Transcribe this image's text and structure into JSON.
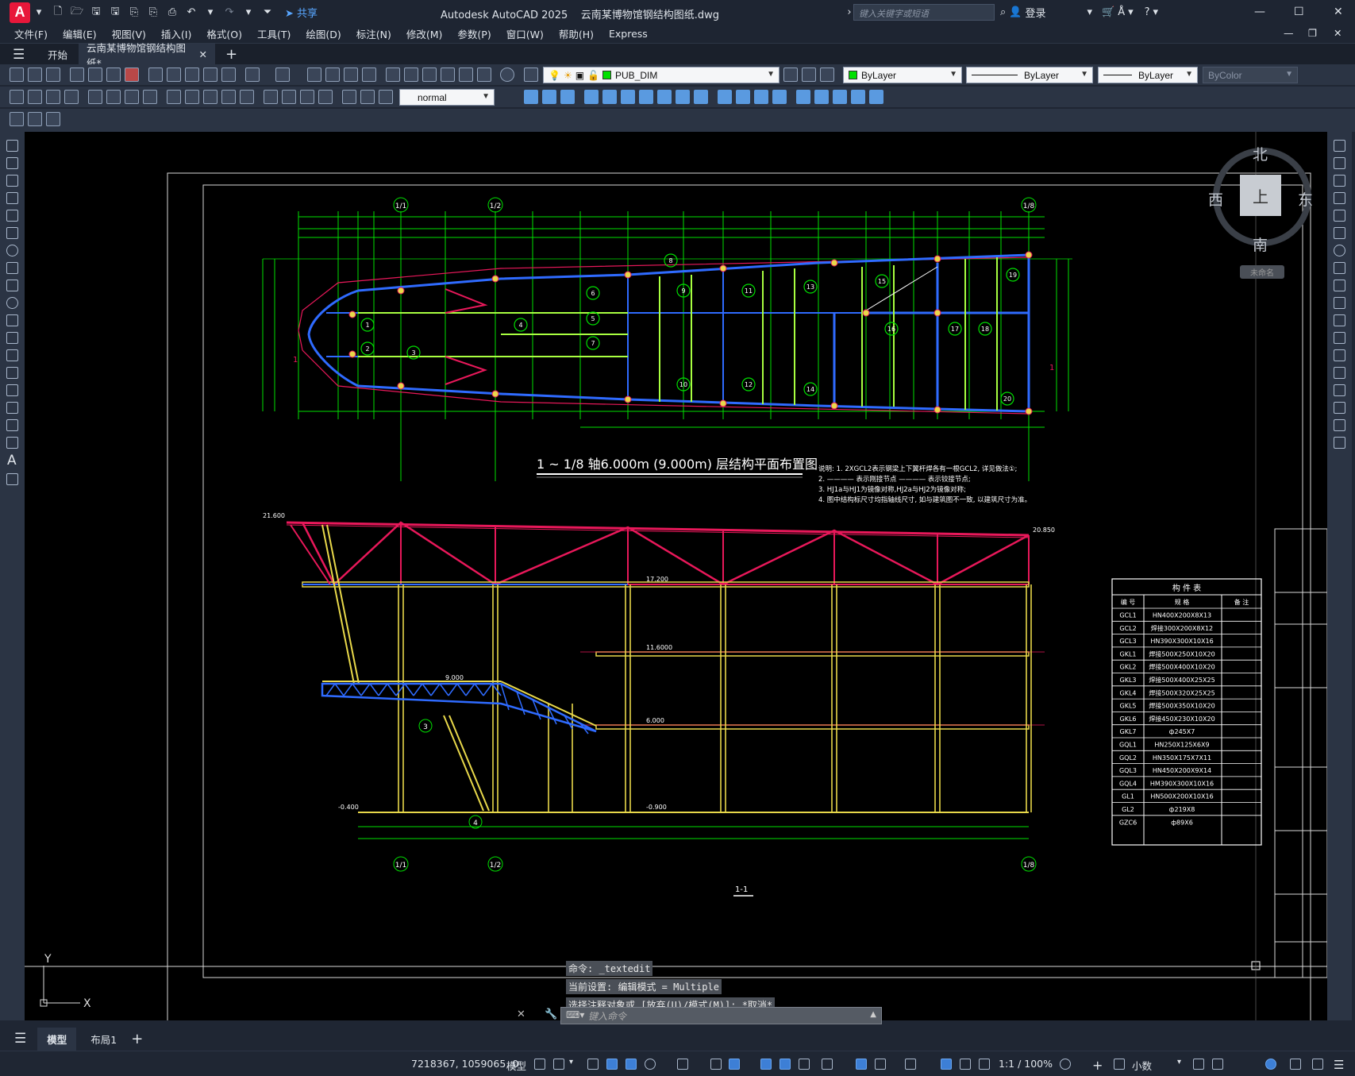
{
  "app": {
    "title": "Autodesk AutoCAD 2025",
    "file": "云南某博物馆钢结构图纸.dwg",
    "share_label": "共享",
    "search_placeholder": "键入关键字或短语",
    "login_label": "登录"
  },
  "menu": [
    "文件(F)",
    "编辑(E)",
    "视图(V)",
    "插入(I)",
    "格式(O)",
    "工具(T)",
    "绘图(D)",
    "标注(N)",
    "修改(M)",
    "参数(P)",
    "窗口(W)",
    "帮助(H)",
    "Express"
  ],
  "tabs": {
    "start": "开始",
    "drawing": "云南某博物馆钢结构图纸*"
  },
  "layer_combo": "PUB_DIM",
  "color_combo": "ByLayer",
  "linetype_combo": "ByLayer",
  "lineweight_combo": "ByLayer",
  "plotstyle_combo": "ByColor",
  "textstyle_combo": "normal",
  "viewcube": {
    "north": "北",
    "south": "南",
    "east": "东",
    "west": "西",
    "face": "上",
    "name": "未命名"
  },
  "drawing": {
    "plan_title": "1 ~ 1/8 轴6.000m (9.000m) 层结构平面布置图",
    "notes": [
      "说明: 1. 2XGCL2表示钢梁上下翼杆焊各有一根GCL2, 详见做法①;",
      "2. ———— 表示刚接节点        ———— 表示铰接节点;",
      "3. HJ1a与HJ1为镜像对称,HJ2a与HJ2为镜像对称;",
      "4. 图中结构标尺寸均指轴线尺寸, 如与建筑图不一致, 以建筑尺寸为准。"
    ],
    "axis_labels": [
      "1/1",
      "1/2",
      "1/8"
    ],
    "elevations": [
      "21.600",
      "17.200",
      "11.6000",
      "6.000",
      "9.000",
      "-0.400",
      "-0.900",
      "20.850"
    ],
    "section_label": "1-1",
    "callouts": [
      "1",
      "2",
      "3",
      "4",
      "5",
      "6",
      "7",
      "8",
      "9",
      "10",
      "11",
      "12",
      "13",
      "14",
      "15",
      "16",
      "17",
      "18",
      "19",
      "20"
    ],
    "coord_axes": {
      "x": "X",
      "y": "Y"
    }
  },
  "member_table": {
    "title": "构 件 表",
    "headers": [
      "编 号",
      "规 格",
      "备 注"
    ],
    "rows": [
      [
        "GCL1",
        "HN400X200X8X13"
      ],
      [
        "GCL2",
        "焊接300X200X8X12"
      ],
      [
        "GCL3",
        "HN390X300X10X16"
      ],
      [
        "GKL1",
        "焊接500X250X10X20"
      ],
      [
        "GKL2",
        "焊接500X400X10X20"
      ],
      [
        "GKL3",
        "焊接500X400X25X25"
      ],
      [
        "GKL4",
        "焊接500X320X25X25"
      ],
      [
        "GKL5",
        "焊接500X350X10X20"
      ],
      [
        "GKL6",
        "焊接450X230X10X20"
      ],
      [
        "GKL7",
        "ф245X7"
      ],
      [
        "GQL1",
        "HN250X125X6X9"
      ],
      [
        "GQL2",
        "HN350X175X7X11"
      ],
      [
        "GQL3",
        "HN450X200X9X14"
      ],
      [
        "GQL4",
        "HM390X300X10X16"
      ],
      [
        "GL1",
        "HN500X200X10X16"
      ],
      [
        "GL2",
        "ф219X8"
      ],
      [
        "GZC6",
        "ф89X6"
      ]
    ]
  },
  "command": {
    "history": [
      "命令: _textedit",
      "当前设置: 编辑模式 = Multiple",
      "选择注释对象或 [放弃(U)/模式(M)]: *取消*"
    ],
    "placeholder": "键入命令"
  },
  "layout_tabs": {
    "model": "模型",
    "layout1": "布局1"
  },
  "status": {
    "coords": "7218367, 1059065, 0",
    "model": "模型",
    "scale": "1:1 / 100%",
    "units": "小数"
  },
  "colors": {
    "grid": "#00e000",
    "beam_blue": "#2f6bff",
    "truss_red": "#e8185a",
    "column_yellow": "#e8d84a",
    "green_member": "#a8ff40"
  }
}
